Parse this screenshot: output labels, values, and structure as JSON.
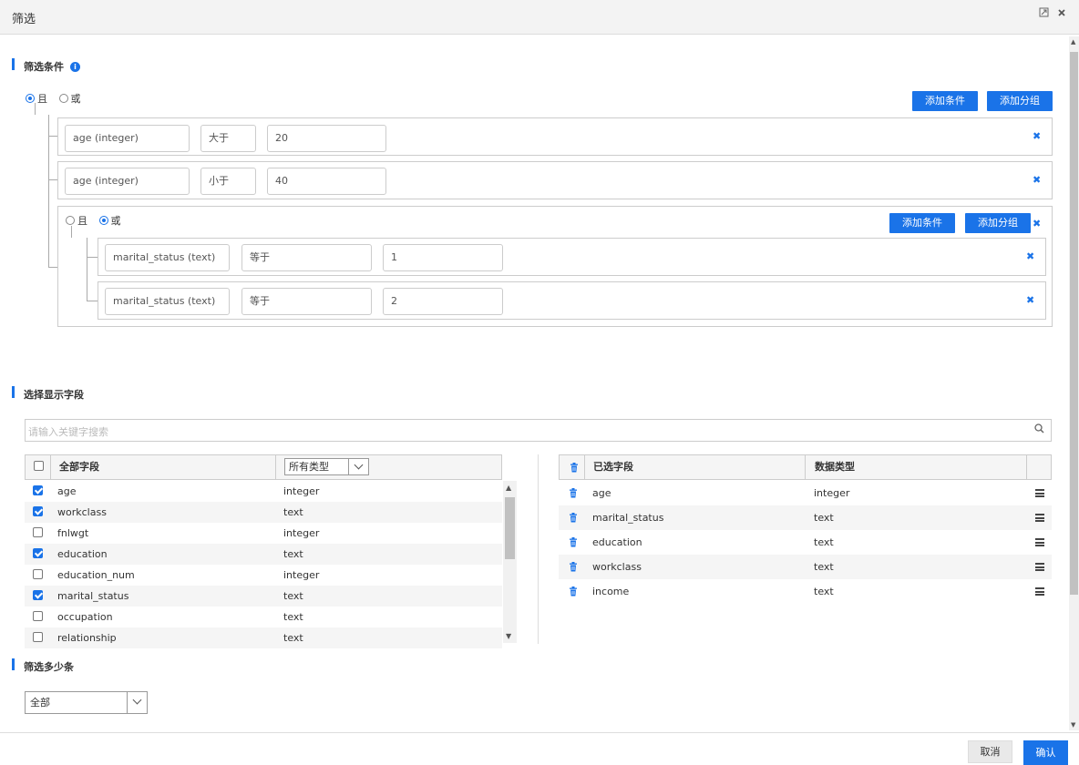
{
  "window": {
    "title": "筛选",
    "maximize_icon": "maximize-icon",
    "close_icon": "close-icon"
  },
  "filter": {
    "section_title": "筛选条件",
    "logic_and": "且",
    "logic_or": "或",
    "selected_logic": "且",
    "add_condition_label": "添加条件",
    "add_group_label": "添加分组",
    "conditions": [
      {
        "field": "age (integer)",
        "operator": "大于",
        "value": "20"
      },
      {
        "field": "age (integer)",
        "operator": "小于",
        "value": "40"
      }
    ],
    "group": {
      "logic_and": "且",
      "logic_or": "或",
      "selected_logic": "或",
      "add_condition_label": "添加条件",
      "add_group_label": "添加分组",
      "conditions": [
        {
          "field": "marital_status (text)",
          "operator": "等于",
          "value": "1"
        },
        {
          "field": "marital_status (text)",
          "operator": "等于",
          "value": "2"
        }
      ]
    }
  },
  "fields": {
    "section_title": "选择显示字段",
    "search_placeholder": "请输入关键字搜索",
    "all_fields_header": "全部字段",
    "type_filter_value": "所有类型",
    "all_fields": [
      {
        "name": "age",
        "type": "integer",
        "checked": true
      },
      {
        "name": "workclass",
        "type": "text",
        "checked": true
      },
      {
        "name": "fnlwgt",
        "type": "integer",
        "checked": false
      },
      {
        "name": "education",
        "type": "text",
        "checked": true
      },
      {
        "name": "education_num",
        "type": "integer",
        "checked": false
      },
      {
        "name": "marital_status",
        "type": "text",
        "checked": true
      },
      {
        "name": "occupation",
        "type": "text",
        "checked": false
      },
      {
        "name": "relationship",
        "type": "text",
        "checked": false
      }
    ],
    "selected_header": "已选字段",
    "data_type_header": "数据类型",
    "selected_fields": [
      {
        "name": "age",
        "type": "integer"
      },
      {
        "name": "marital_status",
        "type": "text"
      },
      {
        "name": "education",
        "type": "text"
      },
      {
        "name": "workclass",
        "type": "text"
      },
      {
        "name": "income",
        "type": "text"
      }
    ]
  },
  "limit": {
    "section_title": "筛选多少条",
    "value": "全部"
  },
  "footer": {
    "cancel_label": "取消",
    "confirm_label": "确认"
  }
}
